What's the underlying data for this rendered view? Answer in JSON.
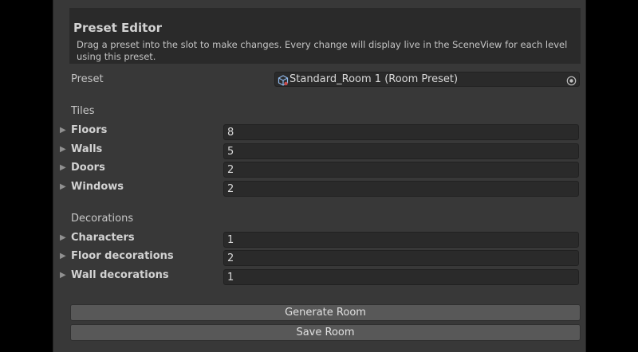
{
  "header": {
    "title": "Preset Editor",
    "description": "Drag a preset into the slot to make changes. Every change will display live in the SceneView for each level using this preset."
  },
  "preset": {
    "label": "Preset",
    "value": "Standard_Room 1 (Room Preset)",
    "object_icon": "prefab-icon",
    "picker_icon": "object-picker-icon"
  },
  "tiles": {
    "header": "Tiles",
    "rows": [
      {
        "label": "Floors",
        "value": "8"
      },
      {
        "label": "Walls",
        "value": "5"
      },
      {
        "label": "Doors",
        "value": "2"
      },
      {
        "label": "Windows",
        "value": "2"
      }
    ]
  },
  "decorations": {
    "header": "Decorations",
    "rows": [
      {
        "label": "Characters",
        "value": "1"
      },
      {
        "label": "Floor decorations",
        "value": "2"
      },
      {
        "label": "Wall decorations",
        "value": "1"
      }
    ]
  },
  "buttons": {
    "generate": "Generate Room",
    "save": "Save Room"
  },
  "foldout_glyph": "▶"
}
